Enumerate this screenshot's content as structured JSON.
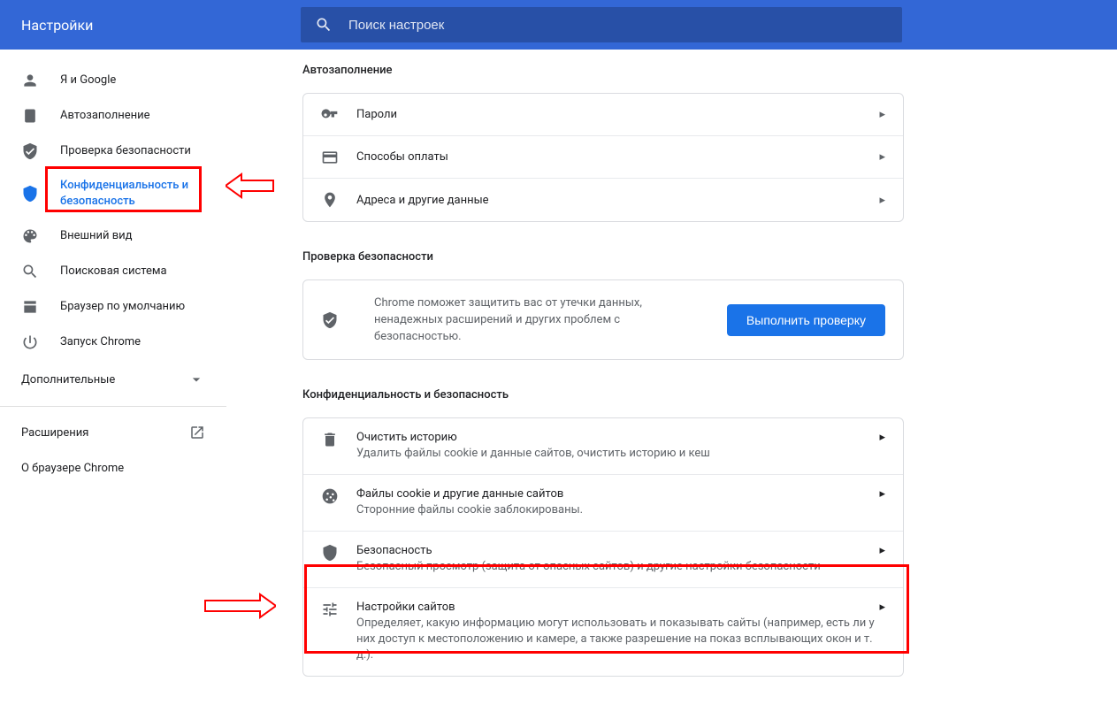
{
  "header": {
    "title": "Настройки",
    "search_placeholder": "Поиск настроек"
  },
  "sidebar": {
    "items": [
      {
        "label": "Я и Google"
      },
      {
        "label": "Автозаполнение"
      },
      {
        "label": "Проверка безопасности"
      },
      {
        "label": "Конфиденциальность и безопасность"
      },
      {
        "label": "Внешний вид"
      },
      {
        "label": "Поисковая система"
      },
      {
        "label": "Браузер по умолчанию"
      },
      {
        "label": "Запуск Chrome"
      }
    ],
    "advanced": "Дополнительные",
    "extensions": "Расширения",
    "about": "О браузере Chrome"
  },
  "sections": {
    "autofill": {
      "title": "Автозаполнение",
      "rows": [
        {
          "label": "Пароли"
        },
        {
          "label": "Способы оплаты"
        },
        {
          "label": "Адреса и другие данные"
        }
      ]
    },
    "safety": {
      "title": "Проверка безопасности",
      "text": "Chrome поможет защитить вас от утечки данных, ненадежных расширений и других проблем с безопасностью.",
      "button": "Выполнить проверку"
    },
    "privacy": {
      "title": "Конфиденциальность и безопасность",
      "rows": [
        {
          "title": "Очистить историю",
          "sub": "Удалить файлы cookie и данные сайтов, очистить историю и кеш"
        },
        {
          "title": "Файлы cookie и другие данные сайтов",
          "sub": "Сторонние файлы cookie заблокированы."
        },
        {
          "title": "Безопасность",
          "sub": "Безопасный просмотр (защита от опасных сайтов) и другие настройки безопасности"
        },
        {
          "title": "Настройки сайтов",
          "sub": "Определяет, какую информацию могут использовать и показывать сайты (например, есть ли у них доступ к местоположению и камере, а также разрешение на показ всплывающих окон и т. д.)."
        }
      ]
    }
  }
}
